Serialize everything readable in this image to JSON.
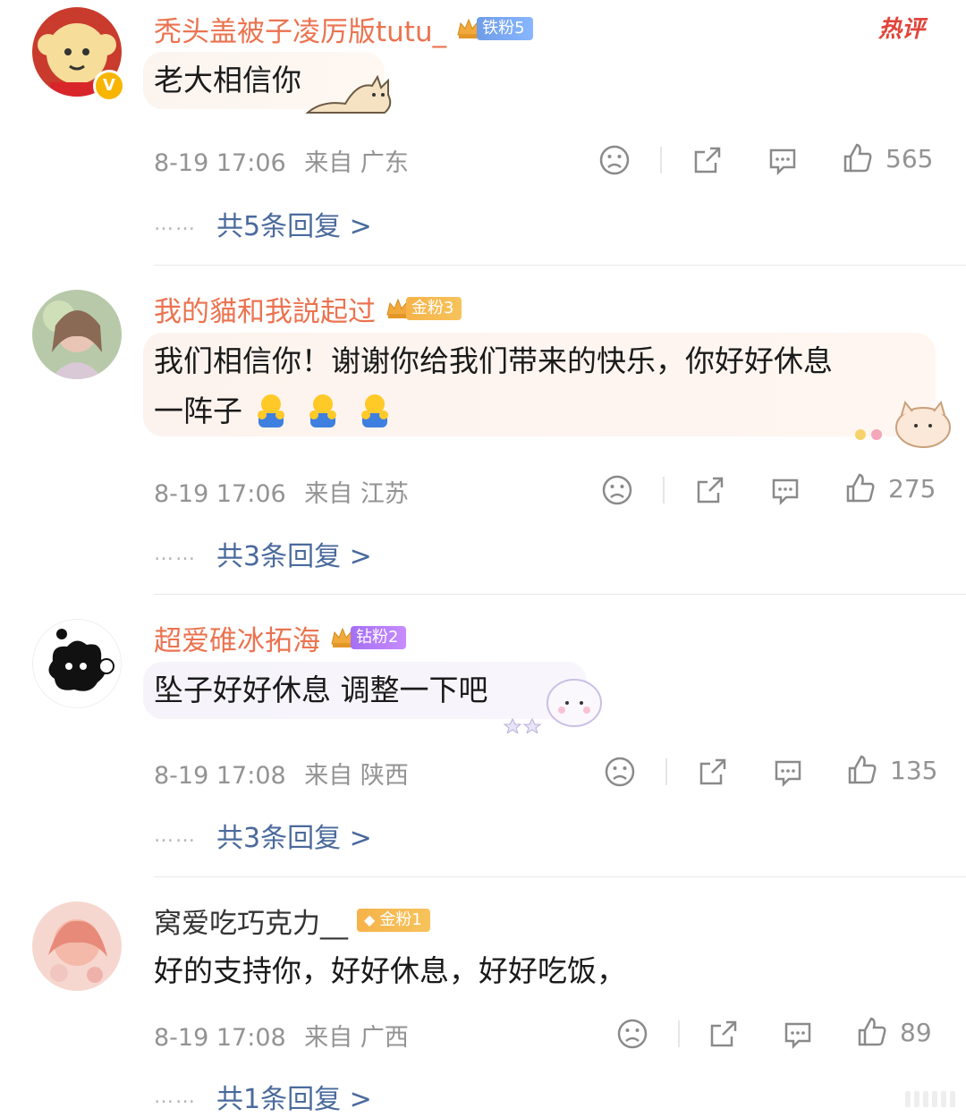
{
  "hot_label": "热评",
  "comments": [
    {
      "username": "秃头盖被子凌厉版tutu_",
      "fan_badge": {
        "level_icon": "4",
        "label": "铁粉5",
        "kind": "iron"
      },
      "verified": true,
      "text": "老大相信你",
      "time": "8-19 17:06",
      "location": "来自 广东",
      "likes": "565",
      "replies": "共5条回复 >",
      "dots": "……"
    },
    {
      "username": "我的貓和我説起过",
      "fan_badge": {
        "level_icon": "5",
        "label": "金粉3",
        "kind": "gold"
      },
      "verified": false,
      "text_line1": "我们相信你！谢谢你给我们带来的快乐，你好好休息",
      "text_line2": "一阵子",
      "time": "8-19 17:06",
      "location": "来自 江苏",
      "likes": "275",
      "replies": "共3条回复 >",
      "dots": "……"
    },
    {
      "username": "超爱碓冰拓海",
      "fan_badge": {
        "level_icon": "6",
        "label": "钻粉2",
        "kind": "diamond"
      },
      "verified": false,
      "text": "坠子好好休息 调整一下吧",
      "time": "8-19 17:08",
      "location": "来自 陕西",
      "likes": "135",
      "replies": "共3条回复 >",
      "dots": "……"
    },
    {
      "username": "窝爱吃巧克力__",
      "fan_badge": {
        "level_icon": "",
        "label": "金粉1",
        "kind": "gold"
      },
      "verified": false,
      "text": "好的支持你，好好休息，好好吃饭，",
      "time": "8-19 17:08",
      "location": "来自 广西",
      "likes": "89",
      "replies": "共1条回复 >",
      "dots": "……"
    }
  ],
  "icons": {
    "dislike": "sad-face-icon",
    "share": "share-icon",
    "comment": "comment-icon",
    "like": "thumbs-up-icon"
  },
  "colors": {
    "username": "#eb7350",
    "reply_link": "#4a6a9c",
    "meta": "#939393",
    "hot": "#e0443a"
  }
}
